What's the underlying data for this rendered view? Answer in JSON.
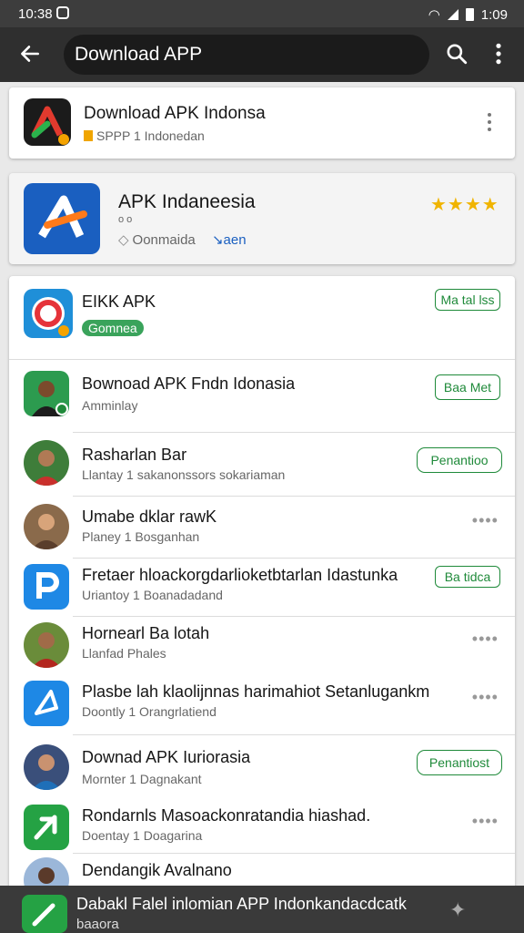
{
  "status": {
    "time": "10:38",
    "clock_right": "1:09"
  },
  "appbar": {
    "search_text": "Download APP"
  },
  "card1": {
    "title": "Download APK Indonsa",
    "subtitle": "SPPP 1 Indonedan"
  },
  "card2": {
    "title": "APK Indaneesia",
    "meta": "o o",
    "tag1": "Oonmaida",
    "tag2": "aen",
    "stars": "★★★★"
  },
  "list": [
    {
      "title": "EIKK APK",
      "subtitle": "",
      "pill": "Gomnea",
      "action": "Ma tal lss",
      "kind": "button"
    },
    {
      "title": "Bownoad APK Fndn Idonasia",
      "subtitle": "Amminlay",
      "action": "Baa Met",
      "kind": "button"
    },
    {
      "title": "Rasharlan Bar",
      "subtitle": "Llantay 1 sakanonssors sokariaman",
      "action": "Penantioo",
      "kind": "button"
    },
    {
      "title": "Umabe dklar rawK",
      "subtitle": "Planey 1 Bosganhan",
      "action": "",
      "kind": "dots"
    },
    {
      "title": "Fretaer hloackorgdarlioketbtarlan Idastunka",
      "subtitle": "Uriantoy 1 Boanadadand",
      "action": "Ba tidca",
      "kind": "button"
    },
    {
      "title": "Hornearl Ba lotah",
      "subtitle": "Llanfad Phales",
      "action": "",
      "kind": "dots"
    },
    {
      "title": "Plasbe lah klaolijnnas harimahiot Setanlugankm",
      "subtitle": "Doontly 1 Orangrlatiend",
      "action": "",
      "kind": "dots"
    },
    {
      "title": "Downad APK Iuriorasia",
      "subtitle": "Mornter 1 Dagnakant",
      "action": "Penantiost",
      "kind": "button"
    },
    {
      "title": "Rondarnls Masoackonratandia hiashad.",
      "subtitle": "Doentay 1 Doagarina",
      "action": "",
      "kind": "dots"
    },
    {
      "title": "Dendangik Avalnano",
      "subtitle": "",
      "action": "",
      "kind": "dots"
    }
  ],
  "bottom": {
    "title": "Dabakl Falel inlomian APP Indonkandacdcatk",
    "subtitle": "baaora"
  },
  "colors": {
    "accent": "#1f8a3a",
    "appbar": "#2f2f2f",
    "star": "#f0b400"
  }
}
